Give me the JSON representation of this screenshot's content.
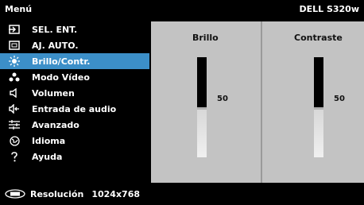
{
  "header": {
    "title": "Menú",
    "model": "DELL S320w"
  },
  "menu": {
    "items": [
      {
        "icon": "input-source-icon",
        "label": "SEL. ENT."
      },
      {
        "icon": "auto-adjust-icon",
        "label": "AJ. AUTO."
      },
      {
        "icon": "brightness-icon",
        "label": "Brillo/Contr.",
        "active": true
      },
      {
        "icon": "video-mode-icon",
        "label": "Modo Vídeo"
      },
      {
        "icon": "volume-icon",
        "label": "Volumen"
      },
      {
        "icon": "audio-input-icon",
        "label": "Entrada de audio"
      },
      {
        "icon": "advanced-settings-icon",
        "label": "Avanzado"
      },
      {
        "icon": "language-icon",
        "label": "Idioma"
      },
      {
        "icon": "help-icon",
        "label": "Ayuda"
      }
    ]
  },
  "panels": {
    "brightness": {
      "title": "Brillo",
      "value": "50",
      "level": 0.5
    },
    "contrast": {
      "title": "Contraste",
      "value": "50",
      "level": 0.5
    }
  },
  "footer": {
    "label": "Resolución",
    "value": "1024x768",
    "icon": "resolution-icon"
  },
  "colors": {
    "active_bg": "#3c8fc8",
    "panel_bg": "#c3c3c3"
  }
}
